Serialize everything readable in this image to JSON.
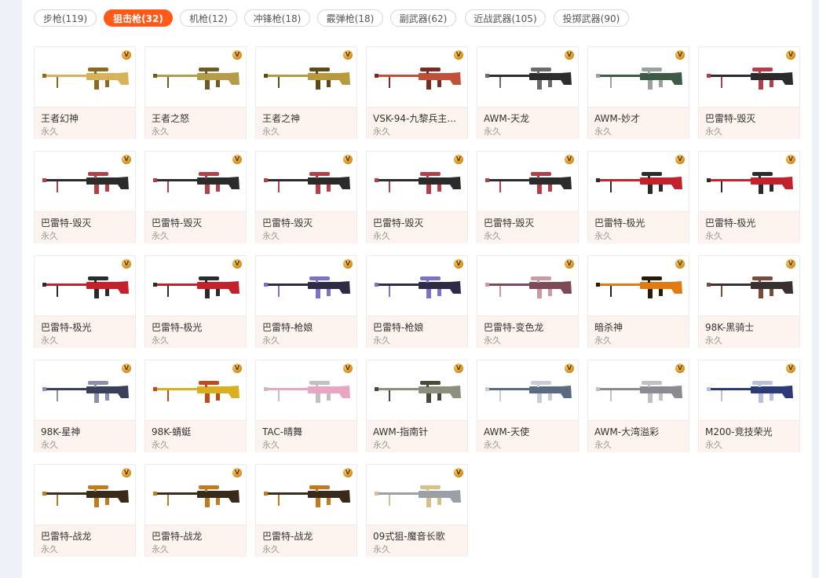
{
  "tabs": [
    {
      "label": "步枪(119)",
      "active": false
    },
    {
      "label": "狙击枪(32)",
      "active": true
    },
    {
      "label": "机枪(12)",
      "active": false
    },
    {
      "label": "冲锋枪(18)",
      "active": false
    },
    {
      "label": "霰弹枪(18)",
      "active": false
    },
    {
      "label": "副武器(62)",
      "active": false
    },
    {
      "label": "近战武器(105)",
      "active": false
    },
    {
      "label": "投掷武器(90)",
      "active": false
    }
  ],
  "badge_label": "V",
  "items": [
    {
      "name": "王者幻神",
      "duration": "永久",
      "body": "#d6b25a",
      "accent": "#8c6a1f",
      "icon": "sniper-rifle-icon"
    },
    {
      "name": "王者之怒",
      "duration": "永久",
      "body": "#b59c4a",
      "accent": "#6f5c25",
      "icon": "sniper-rifle-icon"
    },
    {
      "name": "王者之神",
      "duration": "永久",
      "body": "#b89a3e",
      "accent": "#5e4a18",
      "icon": "sniper-rifle-icon"
    },
    {
      "name": "VSK-94-九黎兵主...",
      "duration": "永久",
      "body": "#c0503a",
      "accent": "#7a2a20",
      "icon": "sniper-rifle-icon"
    },
    {
      "name": "AWM-天龙",
      "duration": "永久",
      "body": "#2d2d2d",
      "accent": "#6b6b6b",
      "icon": "sniper-rifle-icon"
    },
    {
      "name": "AWM-妙才",
      "duration": "永久",
      "body": "#3c5a44",
      "accent": "#9aa39b",
      "icon": "sniper-rifle-icon"
    },
    {
      "name": "巴雷特-毁灭",
      "duration": "永久",
      "body": "#2b2b2b",
      "accent": "#b2404a",
      "icon": "sniper-rifle-icon"
    },
    {
      "name": "巴雷特-毁灭",
      "duration": "永久",
      "body": "#2b2b2b",
      "accent": "#b2404a",
      "icon": "sniper-rifle-icon"
    },
    {
      "name": "巴雷特-毁灭",
      "duration": "永久",
      "body": "#2b2b2b",
      "accent": "#b2404a",
      "icon": "sniper-rifle-icon"
    },
    {
      "name": "巴雷特-毁灭",
      "duration": "永久",
      "body": "#2b2b2b",
      "accent": "#b2404a",
      "icon": "sniper-rifle-icon"
    },
    {
      "name": "巴雷特-毁灭",
      "duration": "永久",
      "body": "#2b2b2b",
      "accent": "#b2404a",
      "icon": "sniper-rifle-icon"
    },
    {
      "name": "巴雷特-毁灭",
      "duration": "永久",
      "body": "#2b2b2b",
      "accent": "#b2404a",
      "icon": "sniper-rifle-icon"
    },
    {
      "name": "巴雷特-极光",
      "duration": "永久",
      "body": "#c2222c",
      "accent": "#2b2b2b",
      "icon": "sniper-rifle-icon"
    },
    {
      "name": "巴雷特-极光",
      "duration": "永久",
      "body": "#c2222c",
      "accent": "#2b2b2b",
      "icon": "sniper-rifle-icon"
    },
    {
      "name": "巴雷特-极光",
      "duration": "永久",
      "body": "#c2222c",
      "accent": "#2b2b2b",
      "icon": "sniper-rifle-icon"
    },
    {
      "name": "巴雷特-极光",
      "duration": "永久",
      "body": "#c2222c",
      "accent": "#2b2b2b",
      "icon": "sniper-rifle-icon"
    },
    {
      "name": "巴雷特-枪娘",
      "duration": "永久",
      "body": "#2d2b45",
      "accent": "#7c72c9",
      "icon": "sniper-rifle-icon"
    },
    {
      "name": "巴雷特-枪娘",
      "duration": "永久",
      "body": "#2d2b45",
      "accent": "#7c72c9",
      "icon": "sniper-rifle-icon"
    },
    {
      "name": "巴雷特-变色龙",
      "duration": "永久",
      "body": "#7e4a55",
      "accent": "#c99aa4",
      "icon": "sniper-rifle-icon"
    },
    {
      "name": "暗杀神",
      "duration": "永久",
      "body": "#e07a12",
      "accent": "#2a1a0a",
      "icon": "sniper-rifle-icon"
    },
    {
      "name": "98K-黑骑士",
      "duration": "永久",
      "body": "#3a3030",
      "accent": "#7a4a3a",
      "icon": "sniper-rifle-icon"
    },
    {
      "name": "98K-星神",
      "duration": "永久",
      "body": "#3a3f5a",
      "accent": "#8a8fb0",
      "icon": "sniper-rifle-icon"
    },
    {
      "name": "98K-蜻蜓",
      "duration": "永久",
      "body": "#d8b020",
      "accent": "#c24a1a",
      "icon": "sniper-rifle-icon"
    },
    {
      "name": "TAC-晴舞",
      "duration": "永久",
      "body": "#e8a6c2",
      "accent": "#c0c0c0",
      "icon": "sniper-rifle-icon"
    },
    {
      "name": "AWM-指南针",
      "duration": "永久",
      "body": "#8e8e7e",
      "accent": "#4a4a3a",
      "icon": "sniper-rifle-icon"
    },
    {
      "name": "AWM-天使",
      "duration": "永久",
      "body": "#5a6a80",
      "accent": "#c8ccd4",
      "icon": "sniper-rifle-icon"
    },
    {
      "name": "AWM-大湾溢彩",
      "duration": "永久",
      "body": "#8a8a90",
      "accent": "#c0c0c6",
      "icon": "sniper-rifle-icon"
    },
    {
      "name": "M200-竞技荣光",
      "duration": "永久",
      "body": "#2c3a7a",
      "accent": "#b8c0e0",
      "icon": "sniper-rifle-icon"
    },
    {
      "name": "巴雷特-战龙",
      "duration": "永久",
      "body": "#3a2a1a",
      "accent": "#c07a20",
      "icon": "sniper-rifle-icon"
    },
    {
      "name": "巴雷特-战龙",
      "duration": "永久",
      "body": "#3a2a1a",
      "accent": "#c07a20",
      "icon": "sniper-rifle-icon"
    },
    {
      "name": "巴雷特-战龙",
      "duration": "永久",
      "body": "#3a2a1a",
      "accent": "#c07a20",
      "icon": "sniper-rifle-icon"
    },
    {
      "name": "09式狙-魔音长歌",
      "duration": "永久",
      "body": "#9aa0a6",
      "accent": "#d6c08a",
      "icon": "sniper-rifle-icon"
    }
  ]
}
